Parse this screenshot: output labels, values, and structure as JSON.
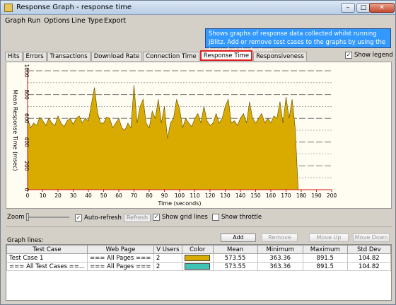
{
  "window": {
    "title": "Response Graph - response time",
    "minimize": "–",
    "maximize": "□",
    "close": "✕",
    "app_icon": "graph-app-icon"
  },
  "menu": [
    "Graph",
    "Run",
    "Options",
    "Line Type",
    "Export"
  ],
  "info": "Shows graphs of response data collected whilst running JBlitz. Add or remove test cases to the graphs by using the legend at the bottom",
  "show_legend": {
    "label": "Show legend",
    "checked": true
  },
  "tabs": [
    "Hits",
    "Errors",
    "Transactions",
    "Download Rate",
    "Connection Time",
    "Response Time",
    "Responsiveness"
  ],
  "active_tab": "Response Time",
  "controls": {
    "zoom_label": "Zoom",
    "auto_refresh": "Auto-refresh",
    "refresh": "Refresh",
    "show_grid": "Show grid lines",
    "show_throttle": "Show throttle",
    "check": "✓"
  },
  "graph_lines_label": "Graph lines:",
  "buttons": {
    "add": "Add",
    "remove": "Remove",
    "move_up": "Move Up",
    "move_down": "Move Down"
  },
  "table": {
    "headers": [
      "Test Case",
      "Web Page",
      "V Users",
      "Color",
      "Mean",
      "Minimum",
      "Maximum",
      "Std Dev"
    ],
    "rows": [
      {
        "test_case": "Test Case 1",
        "web_page": "=== All Pages ===",
        "vusers": "2",
        "color": "#d9aa00",
        "mean": "573.55",
        "min": "363.36",
        "max": "891.5",
        "std": "104.82"
      },
      {
        "test_case": "=== All Test Cases ==...",
        "web_page": "=== All Pages ===",
        "vusers": "2",
        "color": "#3ec3b5",
        "mean": "573.55",
        "min": "363.36",
        "max": "891.5",
        "std": "104.82"
      }
    ]
  },
  "chart_data": {
    "type": "area",
    "xlabel": "Time (seconds)",
    "ylabel": "Mean Response Time (msec)",
    "xlim": [
      0,
      200
    ],
    "ylim": [
      0,
      1000
    ],
    "x_ticks": [
      0,
      10,
      20,
      30,
      40,
      50,
      60,
      70,
      80,
      90,
      100,
      110,
      120,
      130,
      140,
      150,
      160,
      170,
      180,
      190,
      200
    ],
    "y_ticks": [
      0,
      200,
      400,
      600,
      800,
      1000
    ],
    "grid": true,
    "series": [
      {
        "color": "#d9aa00",
        "x": [
          0,
          2,
          4,
          6,
          8,
          10,
          12,
          14,
          16,
          18,
          20,
          22,
          24,
          26,
          28,
          30,
          32,
          34,
          36,
          38,
          40,
          42,
          44,
          46,
          48,
          50,
          52,
          54,
          56,
          58,
          60,
          62,
          64,
          66,
          68,
          70,
          72,
          74,
          76,
          78,
          80,
          82,
          84,
          86,
          88,
          90,
          92,
          94,
          96,
          98,
          100,
          102,
          104,
          106,
          108,
          110,
          112,
          114,
          116,
          118,
          120,
          122,
          124,
          126,
          128,
          130,
          132,
          134,
          136,
          138,
          140,
          142,
          144,
          146,
          148,
          150,
          152,
          154,
          156,
          158,
          160,
          162,
          164,
          166,
          168,
          170,
          172,
          174,
          176,
          178
        ],
        "values": [
          600,
          520,
          560,
          540,
          610,
          580,
          540,
          600,
          560,
          540,
          620,
          560,
          530,
          580,
          600,
          550,
          600,
          620,
          560,
          600,
          580,
          720,
          860,
          650,
          560,
          560,
          610,
          600,
          520,
          560,
          600,
          520,
          500,
          560,
          520,
          880,
          560,
          700,
          760,
          560,
          520,
          660,
          600,
          760,
          560,
          700,
          430,
          560,
          600,
          760,
          680,
          520,
          600,
          560,
          530,
          600,
          640,
          560,
          700,
          580,
          540,
          560,
          640,
          560,
          600,
          700,
          760,
          560,
          580,
          540,
          600,
          640,
          560,
          740,
          600,
          560,
          600,
          640,
          560,
          600,
          560,
          620,
          600,
          740,
          560,
          780,
          600,
          760,
          520,
          0
        ]
      }
    ]
  }
}
